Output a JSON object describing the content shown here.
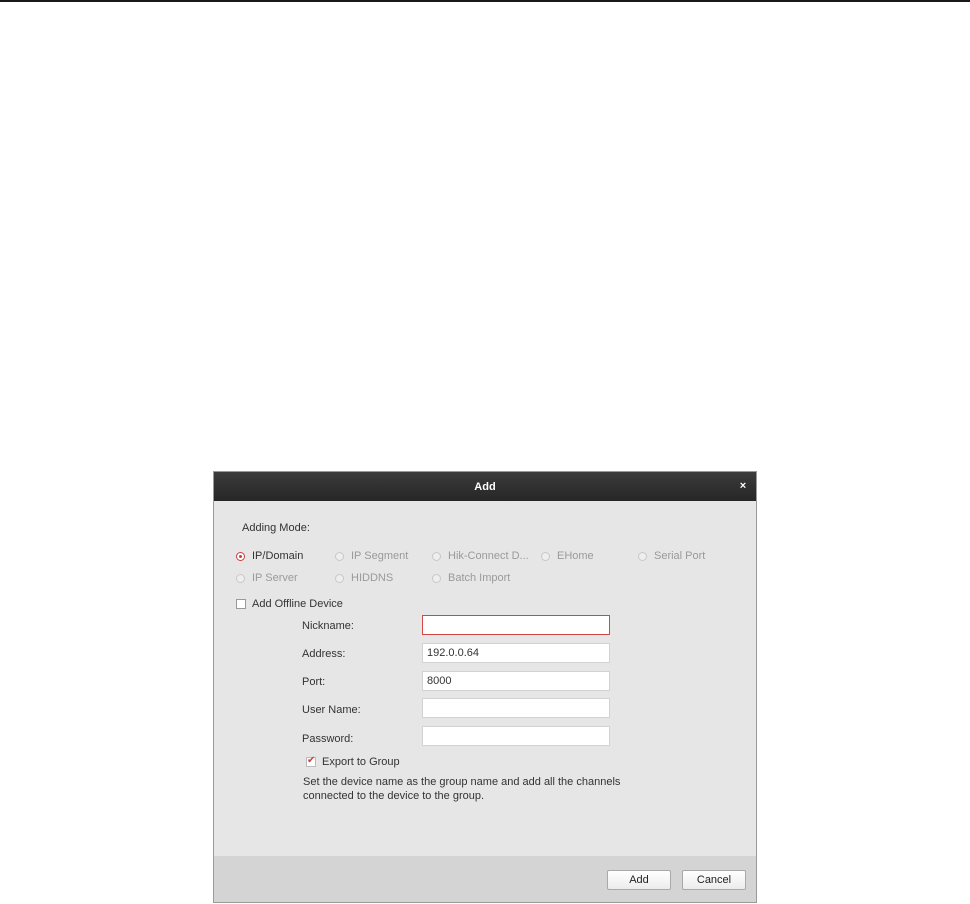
{
  "dialog": {
    "title": "Add",
    "close_glyph": "×",
    "adding_mode_label": "Adding Mode:",
    "modes": [
      {
        "label": "IP/Domain",
        "selected": true
      },
      {
        "label": "IP Segment",
        "selected": false
      },
      {
        "label": "Hik-Connect D...",
        "selected": false
      },
      {
        "label": "EHome",
        "selected": false
      },
      {
        "label": "Serial Port",
        "selected": false
      },
      {
        "label": "IP Server",
        "selected": false
      },
      {
        "label": "HIDDNS",
        "selected": false
      },
      {
        "label": "Batch Import",
        "selected": false
      }
    ],
    "offline_device_label": "Add Offline Device",
    "offline_device_checked": false,
    "fields": {
      "nickname": {
        "label": "Nickname:",
        "value": ""
      },
      "address": {
        "label": "Address:",
        "value": "192.0.0.64"
      },
      "port": {
        "label": "Port:",
        "value": "8000"
      },
      "username": {
        "label": "User Name:",
        "value": ""
      },
      "password": {
        "label": "Password:",
        "value": ""
      }
    },
    "export_group_label": "Export to Group",
    "export_group_checked": true,
    "note": "Set the device name as the group name and add all the channels\nconnected to the device to the group.",
    "buttons": {
      "add": "Add",
      "cancel": "Cancel"
    }
  },
  "colors": {
    "accent": "#d03c3c",
    "titlebar": "#2e2e2e",
    "dialog_bg": "#e6e6e6"
  }
}
